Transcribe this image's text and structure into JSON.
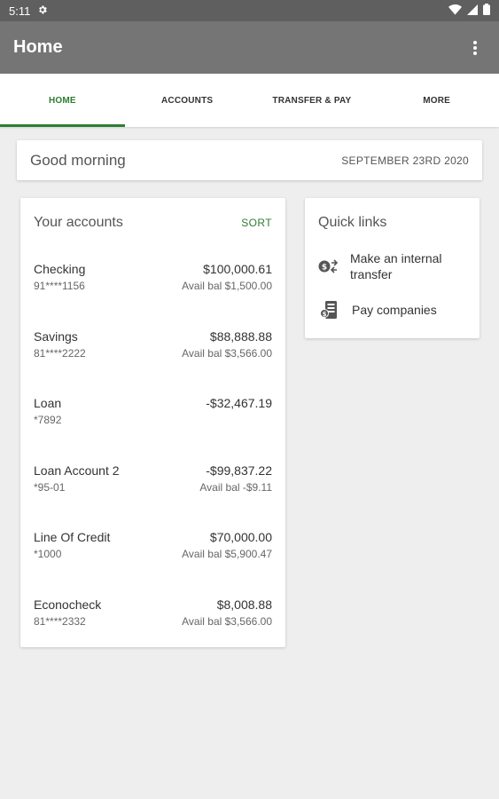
{
  "status": {
    "time": "5:11"
  },
  "appbar": {
    "title": "Home"
  },
  "tabs": [
    {
      "label": "HOME"
    },
    {
      "label": "ACCOUNTS"
    },
    {
      "label": "TRANSFER & PAY"
    },
    {
      "label": "MORE"
    }
  ],
  "greeting": {
    "text": "Good morning",
    "date": "SEPTEMBER 23RD 2020"
  },
  "accounts": {
    "title": "Your accounts",
    "sort_label": "SORT",
    "items": [
      {
        "name": "Checking",
        "number": "91****1156",
        "amount": "$100,000.61",
        "avail": "Avail bal $1,500.00"
      },
      {
        "name": "Savings",
        "number": "81****2222",
        "amount": "$88,888.88",
        "avail": "Avail bal $3,566.00"
      },
      {
        "name": "Loan",
        "number": "*7892",
        "amount": "-$32,467.19",
        "avail": ""
      },
      {
        "name": "Loan Account 2",
        "number": "*95-01",
        "amount": "-$99,837.22",
        "avail": "Avail bal -$9.11"
      },
      {
        "name": "Line Of Credit",
        "number": "*1000",
        "amount": "$70,000.00",
        "avail": "Avail bal $5,900.47"
      },
      {
        "name": "Econocheck",
        "number": "81****2332",
        "amount": "$8,008.88",
        "avail": "Avail bal $3,566.00"
      }
    ]
  },
  "quick_links": {
    "title": "Quick links",
    "items": [
      {
        "label": "Make an internal transfer",
        "icon": "transfer-icon"
      },
      {
        "label": "Pay companies",
        "icon": "bill-pay-icon"
      }
    ]
  },
  "colors": {
    "accent": "#2e7d32",
    "appbar": "#757575",
    "statusbar": "#5f5f5f",
    "background": "#eeeeee"
  }
}
